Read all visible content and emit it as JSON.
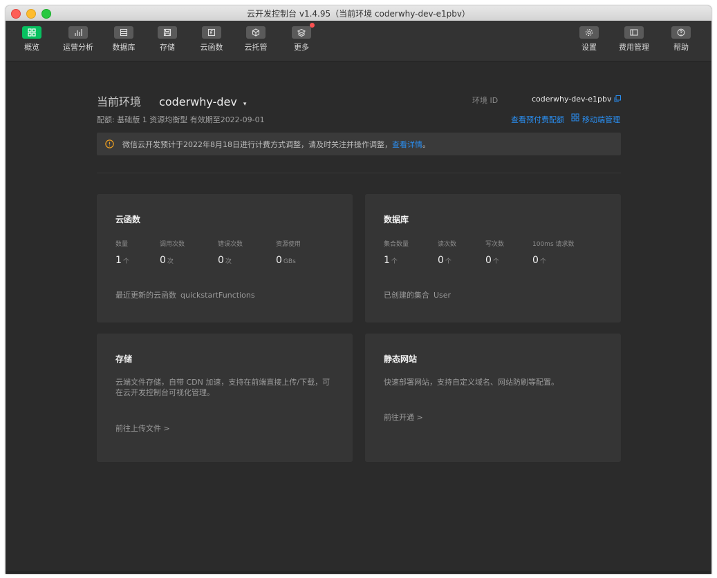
{
  "window": {
    "title": "云开发控制台 v1.4.95（当前环境 coderwhy-dev-e1pbv）"
  },
  "toolbar": {
    "left": [
      {
        "label": "概览",
        "icon": "grid-icon",
        "active": true
      },
      {
        "label": "运营分析",
        "icon": "bar-chart-icon",
        "active": false
      },
      {
        "label": "数据库",
        "icon": "database-icon",
        "active": false
      },
      {
        "label": "存储",
        "icon": "storage-icon",
        "active": false
      },
      {
        "label": "云函数",
        "icon": "function-icon",
        "active": false
      },
      {
        "label": "云托管",
        "icon": "cube-icon",
        "active": false
      },
      {
        "label": "更多",
        "icon": "layers-icon",
        "active": false
      }
    ],
    "right": [
      {
        "label": "设置",
        "icon": "gear-icon"
      },
      {
        "label": "费用管理",
        "icon": "wallet-icon"
      },
      {
        "label": "帮助",
        "icon": "help-icon"
      }
    ]
  },
  "env": {
    "label": "当前环境",
    "name": "coderwhy-dev",
    "caret": "▾",
    "subtitle": "配额: 基础版 1 资源均衡型 有效期至2022-09-01",
    "id_label": "环境 ID",
    "id_value": "coderwhy-dev-e1pbv",
    "link_prepay": "查看预付费配额",
    "link_mobile": "移动端管理"
  },
  "notice": {
    "text": "微信云开发预计于2022年8月18日进行计费方式调整，请及时关注并操作调整，",
    "link": "查看详情",
    "tail": "。"
  },
  "cards": {
    "functions": {
      "title": "云函数",
      "stats": [
        {
          "label": "数量",
          "value": "1",
          "unit": "个"
        },
        {
          "label": "调用次数",
          "value": "0",
          "unit": "次"
        },
        {
          "label": "错误次数",
          "value": "0",
          "unit": "次"
        },
        {
          "label": "资源使用",
          "value": "0",
          "unit": "GBs"
        }
      ],
      "footer_label": "最近更新的云函数",
      "footer_value": "quickstartFunctions"
    },
    "database": {
      "title": "数据库",
      "stats": [
        {
          "label": "集合数量",
          "value": "1",
          "unit": "个"
        },
        {
          "label": "读次数",
          "value": "0",
          "unit": "个"
        },
        {
          "label": "写次数",
          "value": "0",
          "unit": "个"
        },
        {
          "label": "100ms 请求数",
          "value": "0",
          "unit": "个"
        }
      ],
      "footer_label": "已创建的集合",
      "footer_value": "User"
    },
    "storage": {
      "title": "存储",
      "desc": "云端文件存储，自带 CDN 加速，支持在前端直接上传/下载，可在云开发控制台可视化管理。",
      "link": "前往上传文件 >"
    },
    "website": {
      "title": "静态网站",
      "desc": "快速部署网站，支持自定义域名、网站防刷等配置。",
      "link": "前往开通 >"
    }
  },
  "colors": {
    "accent": "#07c160",
    "link": "#2a8ef0",
    "warning": "#f0a020",
    "badge": "#fa5151"
  }
}
